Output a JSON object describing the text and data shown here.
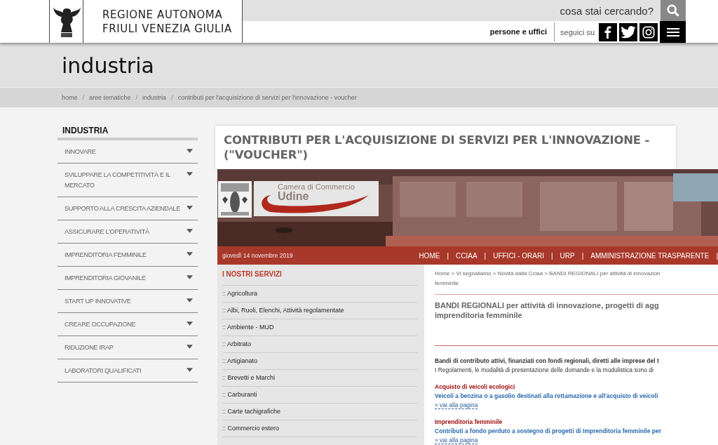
{
  "header": {
    "logo_lines": [
      "REGIONE AUTONOMA",
      "FRIULI VENEZIA GIULIA"
    ],
    "search": {
      "placeholder": "cosa stai cercando?"
    },
    "people_link": "persone e uffici",
    "follow_label": "seguici su",
    "social": [
      {
        "kind": "facebook"
      },
      {
        "kind": "twitter"
      },
      {
        "kind": "instagram"
      }
    ]
  },
  "section_title": "industria",
  "breadcrumb_separator": "/",
  "breadcrumb": [
    "home",
    "aree tematiche",
    "industria",
    "contributi per l'acquisizione di servizi per l'innovazione - voucher"
  ],
  "sidebar": {
    "title": "INDUSTRIA",
    "items": [
      {
        "label": "INNOVARE",
        "expanded": false
      },
      {
        "label": "SVILUPPARE LA COMPETITIVITÀ E IL MERCATO",
        "expanded": false
      },
      {
        "label": "SUPPORTO ALLA CRESCITA AZIENDALE",
        "expanded": false
      },
      {
        "label": "ASSICURARE L'OPERATIVITÀ",
        "expanded": false
      },
      {
        "label": "IMPRENDITORIA FEMMINILE",
        "expanded": false
      },
      {
        "label": "IMPRENDITORIA GIOVANILE",
        "expanded": false
      },
      {
        "label": "START UP INNOVATIVE",
        "expanded": false
      },
      {
        "label": "CREARE OCCUPAZIONE",
        "expanded": false
      },
      {
        "label": "RIDUZIONE IRAP",
        "expanded": false
      },
      {
        "label": "LABORATORI QUALIFICATI",
        "expanded": false
      }
    ]
  },
  "page_title": "CONTRIBUTI PER L'ACQUISIZIONE DI SERVIZI PER L'INNOVAZIONE - (\"VOUCHER\")",
  "embedded": {
    "banner": {
      "kind": "picture",
      "logo_lines": [
        "Camera di Commercio",
        "Udine"
      ]
    },
    "date": "giovedì 14 novembre 2019",
    "nav_separator": "|",
    "nav": [
      "HOME",
      "CCIAA",
      "UFFICI - ORARI",
      "URP",
      "AMMINISTRAZIONE TRASPARENTE"
    ],
    "services_title": "I NOSTRI SERVIZI",
    "bullet": "::",
    "services": [
      "Agricoltura",
      "Albi, Ruoli, Elenchi, Attività regolamentate",
      "Ambiente - MUD",
      "Arbitrato",
      "Artigianato",
      "Brevetti e Marchi",
      "Carburanti",
      "Carte tachigrafiche",
      "Commercio estero"
    ],
    "breadcrumb_lines": [
      "Home > Vi segnaliamo > Novità dalla Cciaa > BANDI REGIONALI per attività di innovazion",
      "femminile"
    ],
    "title_lines": [
      "BANDI REGIONALI per attività di innovazione, progetti di agg",
      "imprenditoria femminile"
    ],
    "intro_lines": [
      {
        "text": "Bandi di contributo attivi, finanziati con fondi regionali, diretti alle imprese del t",
        "bold": true
      },
      {
        "text": "I Regolamenti, le modalità di presentazione delle domande e la modulistica sono di",
        "bold": false
      }
    ],
    "notices": [
      {
        "title": "Acquisto di veicoli ecologici",
        "description": "Veicoli a benzina o a gasolio destinati alla rottamazione e all'acquisto di veicoli",
        "link": "» vai alla pagina"
      },
      {
        "title": "Imprenditoria femminile",
        "description": "Contributi a fondo perduto a sostegno di progetti di Imprenditoria femminile per",
        "link": "» vai alla pagina"
      }
    ]
  }
}
